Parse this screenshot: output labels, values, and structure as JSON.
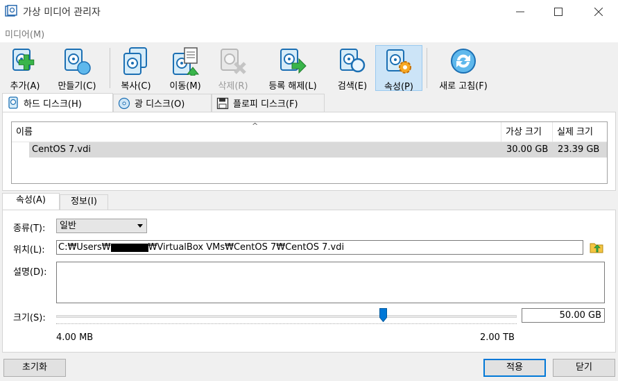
{
  "window": {
    "title": "가상 미디어 관리자",
    "controls": {
      "minimize": "minimize-icon",
      "maximize": "maximize-icon",
      "close": "close-icon"
    }
  },
  "menu": {
    "items": [
      {
        "label": "미디어(M)"
      }
    ]
  },
  "toolbar": {
    "buttons": [
      {
        "label": "추가(A)",
        "icon": "disk-add-icon",
        "enabled": true
      },
      {
        "label": "만들기(C)",
        "icon": "disk-create-icon",
        "enabled": true
      },
      {
        "label": "복사(C)",
        "icon": "disk-copy-icon",
        "enabled": true
      },
      {
        "label": "이동(M)",
        "icon": "disk-move-icon",
        "enabled": true
      },
      {
        "label": "삭제(R)",
        "icon": "disk-remove-icon",
        "enabled": false
      },
      {
        "label": "등록 해제(L)",
        "icon": "disk-release-icon",
        "enabled": true
      },
      {
        "label": "검색(E)",
        "icon": "disk-search-icon",
        "enabled": true
      },
      {
        "label": "속성(P)",
        "icon": "disk-properties-icon",
        "enabled": true,
        "pressed": true
      },
      {
        "label": "새로 고침(F)",
        "icon": "refresh-icon",
        "enabled": true
      }
    ]
  },
  "media_tabs": [
    {
      "label": "하드 디스크(H)",
      "icon": "hard-disk-icon",
      "active": true
    },
    {
      "label": "광 디스크(O)",
      "icon": "optical-disk-icon",
      "active": false
    },
    {
      "label": "플로피 디스크(F)",
      "icon": "floppy-disk-icon",
      "active": false
    }
  ],
  "disk_list": {
    "columns": [
      "이름",
      "가상 크기",
      "실제 크기"
    ],
    "sort_indicator": "^",
    "rows": [
      {
        "name": "CentOS 7.vdi",
        "virtual_size": "30.00 GB",
        "actual_size": "23.39 GB",
        "selected": true
      }
    ]
  },
  "detail_tabs": [
    {
      "label": "속성(A)",
      "active": true
    },
    {
      "label": "정보(I)",
      "active": false
    }
  ],
  "properties": {
    "type_label": "종류(T):",
    "type_value": "일반",
    "location_label": "위치(L):",
    "location_prefix": "C:₩Users₩",
    "location_suffix": "₩VirtualBox VMs₩CentOS 7₩CentOS 7.vdi",
    "description_label": "설명(D):",
    "description_value": "",
    "size_label": "크기(S):",
    "size_value": "50.00 GB",
    "size_min": "4.00 MB",
    "size_max": "2.00 TB",
    "slider_fraction": 0.71
  },
  "buttons": {
    "reset": "초기화",
    "apply": "적용",
    "close": "닫기"
  }
}
